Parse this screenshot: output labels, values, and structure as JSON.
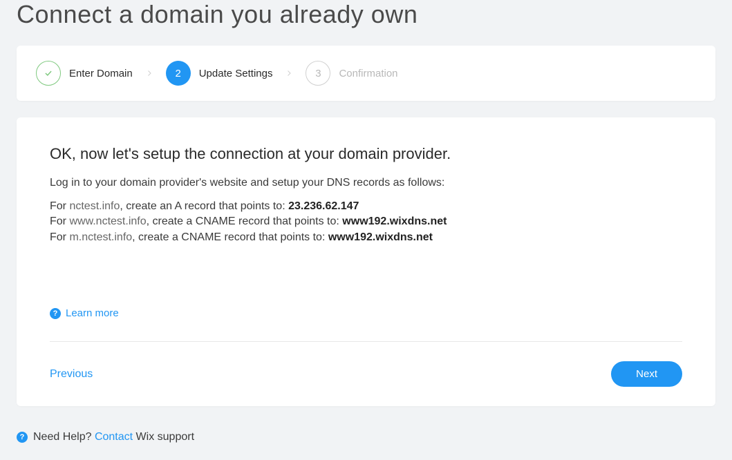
{
  "page": {
    "title": "Connect a domain you already own"
  },
  "stepper": {
    "steps": [
      {
        "badge": "✓",
        "label": "Enter Domain",
        "state": "done"
      },
      {
        "badge": "2",
        "label": "Update Settings",
        "state": "active"
      },
      {
        "badge": "3",
        "label": "Confirmation",
        "state": "pending"
      }
    ]
  },
  "content": {
    "heading": "OK, now let's setup the connection at your domain provider.",
    "instruction": "Log in to your domain provider's website and setup your DNS records as follows:",
    "records": [
      {
        "prefix": "For",
        "domain": "nctest.info",
        "suffix": ", create an A record that points to:",
        "target": "23.236.62.147"
      },
      {
        "prefix": "For",
        "domain": "www.nctest.info",
        "suffix": ", create a CNAME record that points to:",
        "target": "www192.wixdns.net"
      },
      {
        "prefix": "For",
        "domain": "m.nctest.info",
        "suffix": ", create a CNAME record that points to:",
        "target": "www192.wixdns.net"
      }
    ],
    "learn_more": "Learn more"
  },
  "actions": {
    "previous": "Previous",
    "next": "Next"
  },
  "footer": {
    "need_help": "Need Help?",
    "contact": "Contact",
    "support_suffix": " Wix support"
  }
}
